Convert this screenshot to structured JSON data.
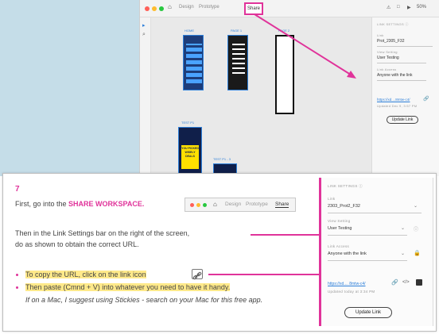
{
  "top_screenshot": {
    "tabs": [
      "Design",
      "Prototype",
      "Share"
    ],
    "right_status": [
      "⚠",
      "□",
      "▶",
      "50%"
    ],
    "artboard_labels": [
      "HOME",
      "PAGE 1",
      "PAGE 2",
      "TEST P1",
      "TEST P1 - 3"
    ],
    "promo_text": "YOU PICKED WISELY DEALS",
    "panel": {
      "section": "LINK SETTINGS ⓘ",
      "name_label": "Link",
      "name_value": "Prot_2305_F32",
      "view_label": "View Setting",
      "view_value": "User Testing",
      "access_label": "Link Access",
      "access_value": "Anyone with the link",
      "link_text": "https://xd....8mtw-c4/",
      "updated": "Updated Dec 9, 3:57 PM",
      "update_button": "Update Link"
    }
  },
  "doc": {
    "step_number": "7",
    "line1_prefix": "First, go into the ",
    "line1_highlight": "SHARE WORKSPACE.",
    "inline_tabs": [
      "Design",
      "Prototype",
      "Share"
    ],
    "line2": "Then in the Link Settings bar on the right of the screen,",
    "line3": "do as shown to obtain the correct URL.",
    "bullet1": "To copy the URL, click on the link icon",
    "bullet2": "Then paste (Cmnd + V) into whatever you need to have it handy.",
    "note": "If on a Mac, I suggest using Stickies - search on your Mac for this free app.",
    "panel": {
      "section": "LINK SETTINGS ⓘ",
      "name_label": "Link",
      "name_value": "2303_Prot2_F32",
      "view_label": "View Setting",
      "view_value": "User Testing",
      "access_label": "Link Access",
      "access_value": "Anyone with the link",
      "link_text": "https://xd.... 8mtw-c4/",
      "updated": "Updated today at 3:34 PM",
      "update_button": "Update Link"
    }
  },
  "colors": {
    "accent_pink": "#e0339a",
    "highlight_yellow": "#ffe98a",
    "xd_blue": "#2d7fd9",
    "top_background": "#c5dde8"
  }
}
